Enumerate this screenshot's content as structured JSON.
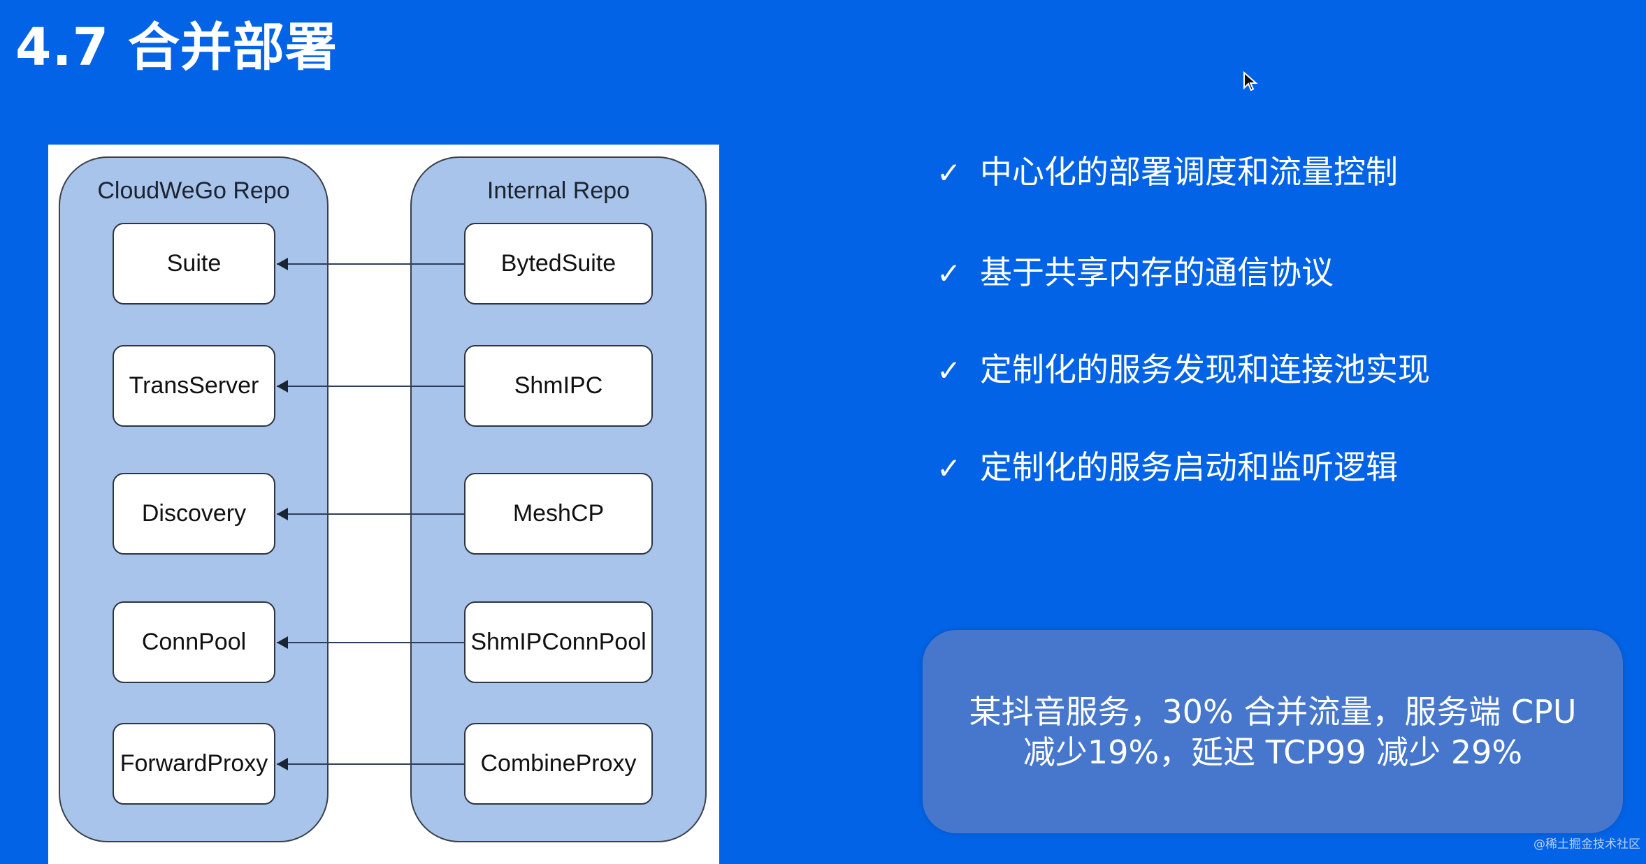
{
  "slide": {
    "title": "4.7 合并部署"
  },
  "diagram": {
    "left_repo": {
      "label": "CloudWeGo Repo",
      "nodes": [
        "Suite",
        "TransServer",
        "Discovery",
        "ConnPool",
        "ForwardProxy"
      ]
    },
    "right_repo": {
      "label": "Internal Repo",
      "nodes": [
        "BytedSuite",
        "ShmIPC",
        "MeshCP",
        "ShmIPConnPool",
        "CombineProxy"
      ]
    },
    "edges": [
      {
        "from": "BytedSuite",
        "to": "Suite"
      },
      {
        "from": "ShmIPC",
        "to": "TransServer"
      },
      {
        "from": "MeshCP",
        "to": "Discovery"
      },
      {
        "from": "ShmIPConnPool",
        "to": "ConnPool"
      },
      {
        "from": "CombineProxy",
        "to": "ForwardProxy"
      }
    ]
  },
  "checklist": {
    "icon": "check-icon",
    "icon_glyph": "✓",
    "items": [
      "中心化的部署调度和流量控制",
      "基于共享内存的通信协议",
      "定制化的服务发现和连接池实现",
      "定制化的服务启动和监听逻辑"
    ]
  },
  "result": {
    "line1": "某抖音服务，30% 合并流量，服务端 CPU",
    "line2": "减少19%，延迟 TCP99 减少 29%"
  },
  "watermark": "@稀土掘金技术社区",
  "colors": {
    "background": "#0363e6",
    "repo_fill": "#a8c4ea",
    "result_box": "#4677cc"
  }
}
